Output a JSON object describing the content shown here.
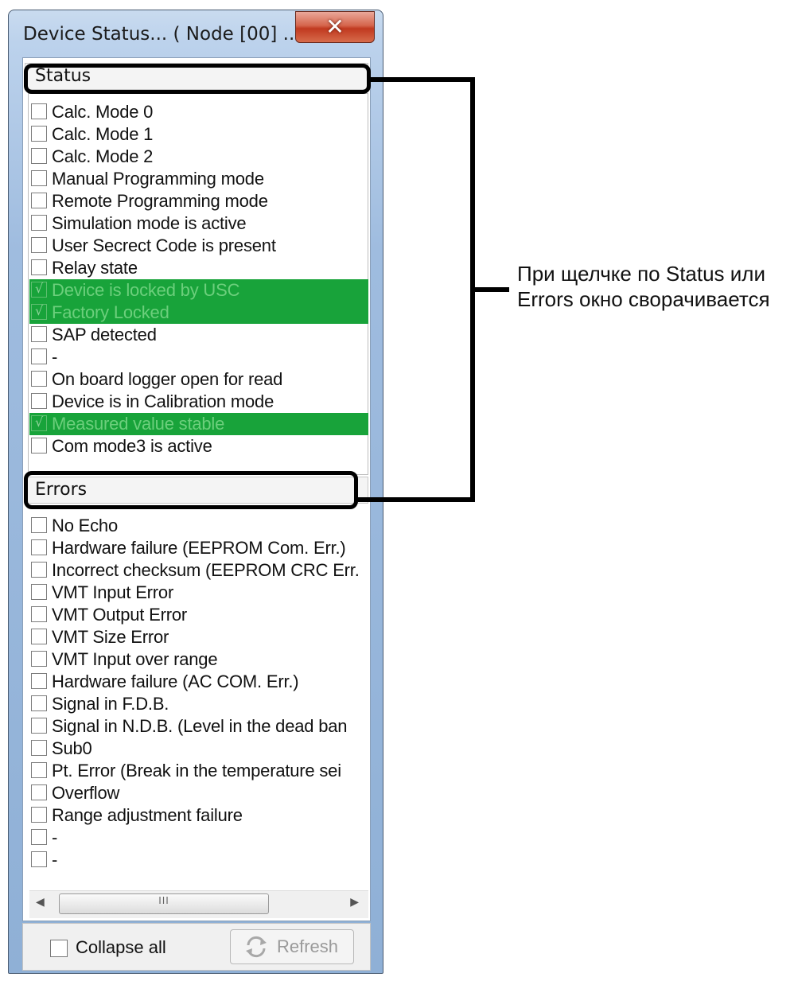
{
  "window": {
    "title": "Device Status... ( Node [00] ...",
    "close_glyph": "✕"
  },
  "status": {
    "header": "Status",
    "items": [
      {
        "label": "Calc. Mode 0",
        "checked": false,
        "highlight": false
      },
      {
        "label": "Calc. Mode 1",
        "checked": false,
        "highlight": false
      },
      {
        "label": "Calc. Mode 2",
        "checked": false,
        "highlight": false
      },
      {
        "label": "Manual Programming mode",
        "checked": false,
        "highlight": false
      },
      {
        "label": "Remote Programming mode",
        "checked": false,
        "highlight": false
      },
      {
        "label": "Simulation mode is active",
        "checked": false,
        "highlight": false
      },
      {
        "label": "User Secrect Code is present",
        "checked": false,
        "highlight": false
      },
      {
        "label": "Relay state",
        "checked": false,
        "highlight": false
      },
      {
        "label": "Device is locked by USC",
        "checked": true,
        "highlight": true
      },
      {
        "label": "Factory Locked",
        "checked": true,
        "highlight": true
      },
      {
        "label": "SAP detected",
        "checked": false,
        "highlight": false
      },
      {
        "label": "-",
        "checked": false,
        "highlight": false
      },
      {
        "label": "On board logger open for read",
        "checked": false,
        "highlight": false
      },
      {
        "label": "Device is in Calibration mode",
        "checked": false,
        "highlight": false
      },
      {
        "label": "Measured value stable",
        "checked": true,
        "highlight": true
      },
      {
        "label": "Com mode3 is active",
        "checked": false,
        "highlight": false
      }
    ]
  },
  "errors": {
    "header": "Errors",
    "items": [
      {
        "label": "No Echo",
        "checked": false,
        "highlight": false
      },
      {
        "label": "Hardware failure (EEPROM Com. Err.)",
        "checked": false,
        "highlight": false
      },
      {
        "label": "Incorrect checksum (EEPROM CRC Err.",
        "checked": false,
        "highlight": false
      },
      {
        "label": "VMT Input Error",
        "checked": false,
        "highlight": false
      },
      {
        "label": "VMT Output Error",
        "checked": false,
        "highlight": false
      },
      {
        "label": "VMT Size Error",
        "checked": false,
        "highlight": false
      },
      {
        "label": "VMT Input over range",
        "checked": false,
        "highlight": false
      },
      {
        "label": "Hardware failure (AC COM. Err.)",
        "checked": false,
        "highlight": false
      },
      {
        "label": "Signal in F.D.B.",
        "checked": false,
        "highlight": false
      },
      {
        "label": "Signal in N.D.B. (Level in the dead ban",
        "checked": false,
        "highlight": false
      },
      {
        "label": "Sub0",
        "checked": false,
        "highlight": false
      },
      {
        "label": "Pt. Error (Break in the temperature sei",
        "checked": false,
        "highlight": false
      },
      {
        "label": "Overflow",
        "checked": false,
        "highlight": false
      },
      {
        "label": "Range adjustment failure",
        "checked": false,
        "highlight": false
      },
      {
        "label": "-",
        "checked": false,
        "highlight": false
      },
      {
        "label": "-",
        "checked": false,
        "highlight": false
      }
    ]
  },
  "scrollbar": {
    "left_arrow": "◀",
    "right_arrow": "▶",
    "grip": "III"
  },
  "footer": {
    "collapse_label": "Collapse all",
    "collapse_checked": false,
    "refresh_label": "Refresh",
    "refresh_enabled": false
  },
  "annotation": {
    "line1": "При щелчке по Status или",
    "line2": "Errors окно сворачивается"
  },
  "colors": {
    "highlight": "#18a33a",
    "highlight_text": "#6ccf7c"
  }
}
